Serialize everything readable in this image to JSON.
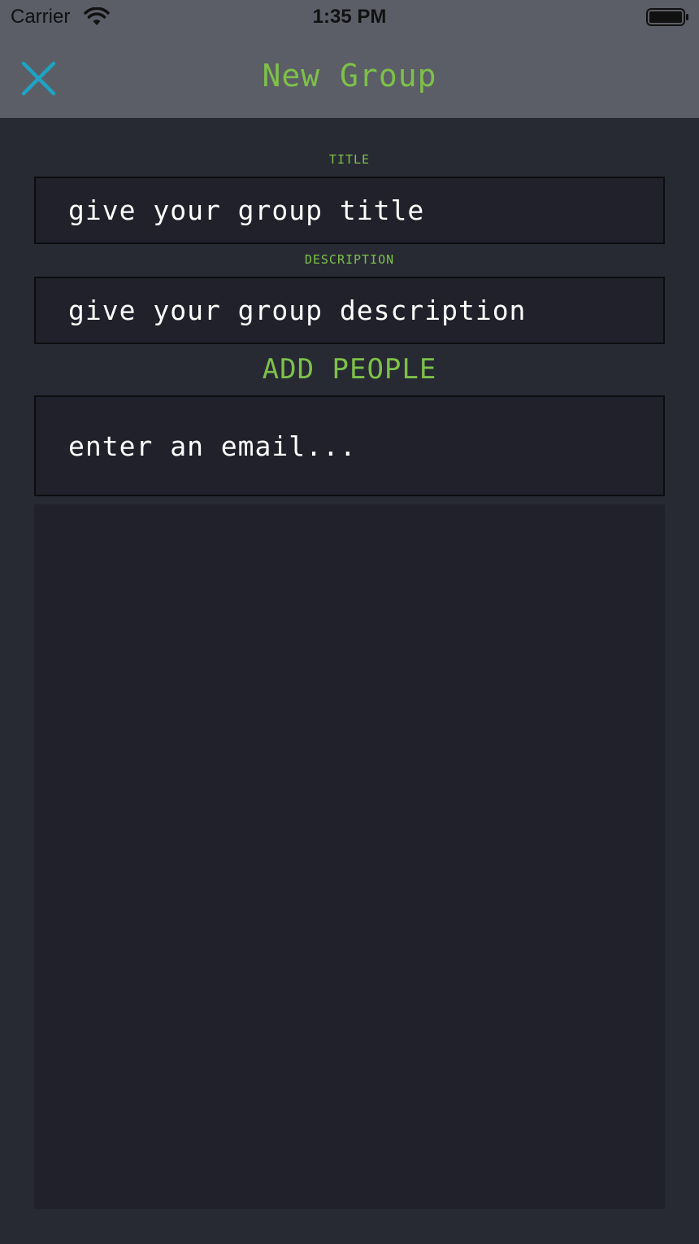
{
  "status_bar": {
    "carrier": "Carrier",
    "time": "1:35 PM",
    "wifi_icon": "wifi-icon",
    "battery_icon": "battery-icon"
  },
  "nav": {
    "title": "New Group",
    "close_icon": "close-icon"
  },
  "form": {
    "title_label": "TITLE",
    "title_placeholder": "give your group title",
    "description_label": "DESCRIPTION",
    "description_placeholder": "give your group description",
    "add_people_label": "ADD PEOPLE",
    "email_placeholder": "enter an email..."
  },
  "colors": {
    "accent_green": "#7ec04a",
    "close_icon": "#1fa3c2",
    "background": "#272a33",
    "field_background": "#20212a",
    "bar_background": "#5b5e66"
  }
}
